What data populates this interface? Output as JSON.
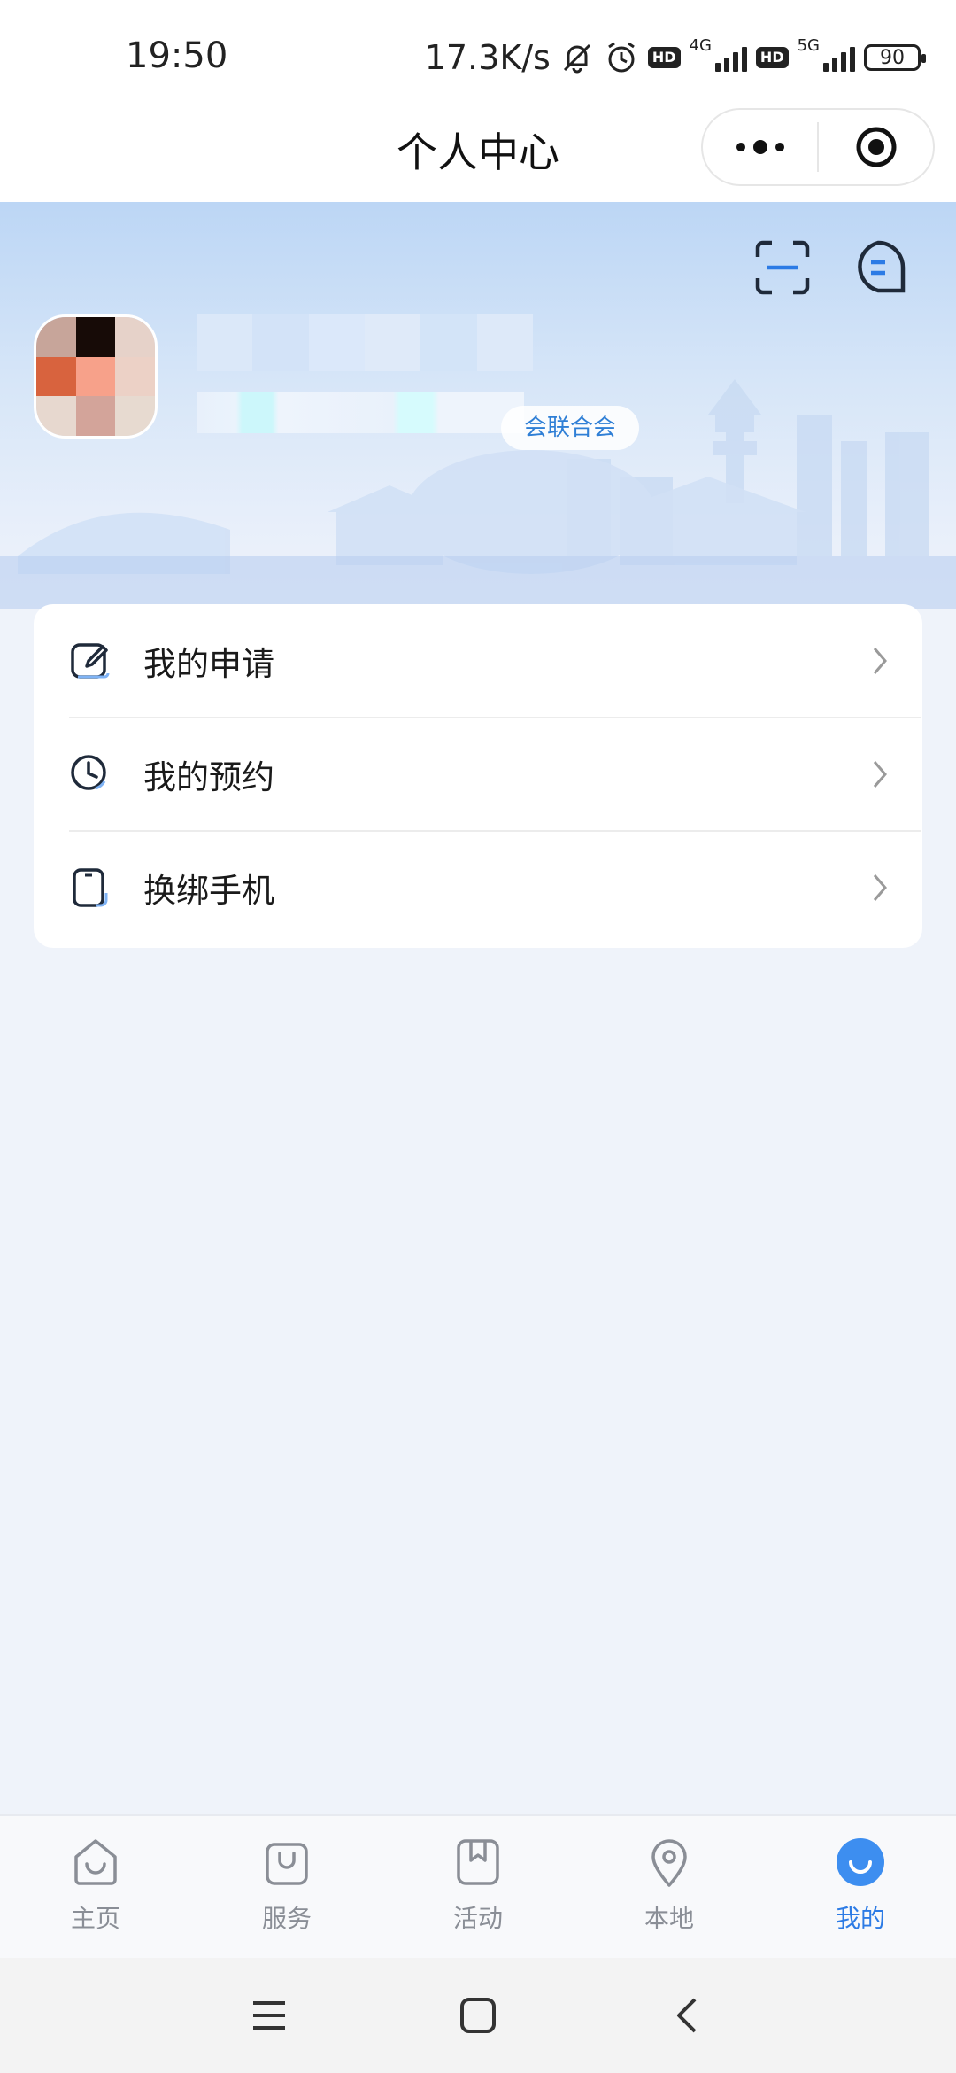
{
  "status_bar": {
    "time": "19:50",
    "net_speed": "17.3K/s",
    "hd1": "HD",
    "net1": "4G",
    "hd2": "HD",
    "net2": "5G",
    "battery": "90"
  },
  "nav": {
    "title": "个人中心",
    "more_icon": "more-dots-icon",
    "close_icon": "target-circle-icon"
  },
  "profile": {
    "scan_icon": "scan-icon",
    "message_icon": "message-bubble-icon",
    "org_tag": "会联合会"
  },
  "menu": {
    "items": [
      {
        "label": "我的申请",
        "icon": "edit-note-icon"
      },
      {
        "label": "我的预约",
        "icon": "clock-icon"
      },
      {
        "label": "换绑手机",
        "icon": "phone-icon"
      }
    ]
  },
  "tabbar": {
    "items": [
      {
        "label": "主页",
        "icon": "home-icon",
        "active": false
      },
      {
        "label": "服务",
        "icon": "shopping-bag-icon",
        "active": false
      },
      {
        "label": "活动",
        "icon": "bookmark-icon",
        "active": false
      },
      {
        "label": "本地",
        "icon": "location-pin-icon",
        "active": false
      },
      {
        "label": "我的",
        "icon": "profile-smile-icon",
        "active": true
      }
    ],
    "active_color": "#2c7be5",
    "inactive_color": "#8a8e96"
  },
  "system_nav": {
    "menu_icon": "menu-lines-icon",
    "home_icon": "home-square-icon",
    "back_icon": "back-chevron-icon"
  },
  "colors": {
    "accent": "#2c7be5",
    "page_bg": "#eff3fa",
    "banner_top": "#bcd6f5"
  }
}
